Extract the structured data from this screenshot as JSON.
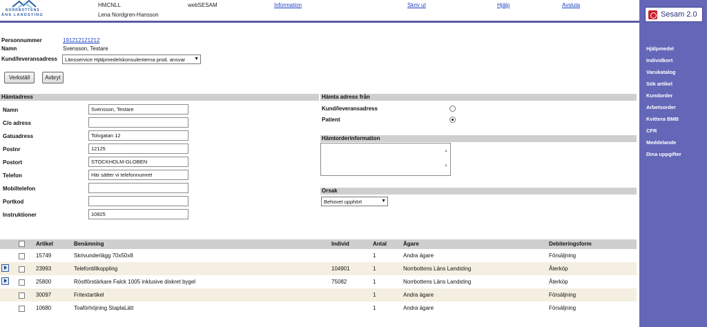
{
  "header": {
    "logo_line1": "NORRBOTTENS",
    "logo_line2": "ÄNS LANDSTING",
    "org_code": "HMCNLL",
    "user_name": "Lena Nordgren-Hansson",
    "app_name": "webSESAM",
    "links": {
      "information": "Information",
      "print": "Skriv ut",
      "help": "Hjälp",
      "quit": "Avsluta"
    }
  },
  "sidebar": {
    "badge": "Sesam 2.0",
    "items": [
      "Hjälpmedel",
      "Individkort",
      "Varukatalog",
      "Sök artikel",
      "Kundorder",
      "Arbetsorder",
      "Kvittera BMB",
      "CFR",
      "Meddelande",
      "Dina uppgifter"
    ]
  },
  "person": {
    "pnr_label": "Personnummer",
    "pnr_value": "191212121212",
    "name_label": "Namn",
    "name_value": "Svensson, Testare",
    "customer_label": "Kund/leveransadress",
    "customer_value": "Länsservice Hjälpmedelskonsulenterna prod. ansvar"
  },
  "buttons": {
    "execute": "Verkställ",
    "cancel": "Avbryt"
  },
  "pickup": {
    "title": "Hämtadress",
    "fields": [
      {
        "label": "Namn",
        "value": "Svensson, Testare"
      },
      {
        "label": "C/o adress",
        "value": ""
      },
      {
        "label": "Gatuadress",
        "value": "Tolvgatan 12"
      },
      {
        "label": "Postnr",
        "value": "12125"
      },
      {
        "label": "Postort",
        "value": "STOCKHOLM-GLOBEN"
      },
      {
        "label": "Telefon",
        "value": "Här sätter vi telefonnumret"
      },
      {
        "label": "Mobiltelefon",
        "value": ""
      },
      {
        "label": "Portkod",
        "value": ""
      },
      {
        "label": "Instruktioner",
        "value": "10825"
      }
    ]
  },
  "fetch_from": {
    "title": "Hämta adress från",
    "option_customer": "Kund/leveransadress",
    "option_patient": "Patient",
    "selected": "Patient"
  },
  "order_info": {
    "title": "Hämtorderinformation",
    "value": ""
  },
  "reason": {
    "title": "Orsak",
    "selected": "Behovet upphört"
  },
  "table": {
    "columns": [
      "Artikel",
      "Benämning",
      "Individ",
      "Antal",
      "Ägare",
      "Debiteringsform"
    ],
    "rows": [
      {
        "artikel": "15749",
        "benamning": "Skrivunderlägg 70x50x8",
        "individ": "",
        "antal": "1",
        "agare": "Andra ägare",
        "debitering": "Försäljning",
        "icon": false
      },
      {
        "artikel": "23993",
        "benamning": "Telefontillkoppling",
        "individ": "104901",
        "antal": "1",
        "agare": "Norrbottens Läns Landsting",
        "debitering": "Återköp",
        "icon": true
      },
      {
        "artikel": "25800",
        "benamning": "Röstförstärkare Falck 1005 inklusive diskret bygel",
        "individ": "75082",
        "antal": "1",
        "agare": "Norrbottens Läns Landsting",
        "debitering": "Återköp",
        "icon": true
      },
      {
        "artikel": "30097",
        "benamning": "Fritextartikel",
        "individ": "",
        "antal": "1",
        "agare": "Andra ägare",
        "debitering": "Försäljning",
        "icon": false
      },
      {
        "artikel": "10680",
        "benamning": "Toaförhöjning StaplaLätt",
        "individ": "",
        "antal": "1",
        "agare": "Andra ägare",
        "debitering": "Försäljning",
        "icon": false
      }
    ]
  },
  "colors": {
    "sidebar": "#6466b8",
    "header_rule": "#5a5aa8",
    "section": "#cfcfcf",
    "row_alt": "#f4efe1",
    "link": "#1a3fc0"
  }
}
